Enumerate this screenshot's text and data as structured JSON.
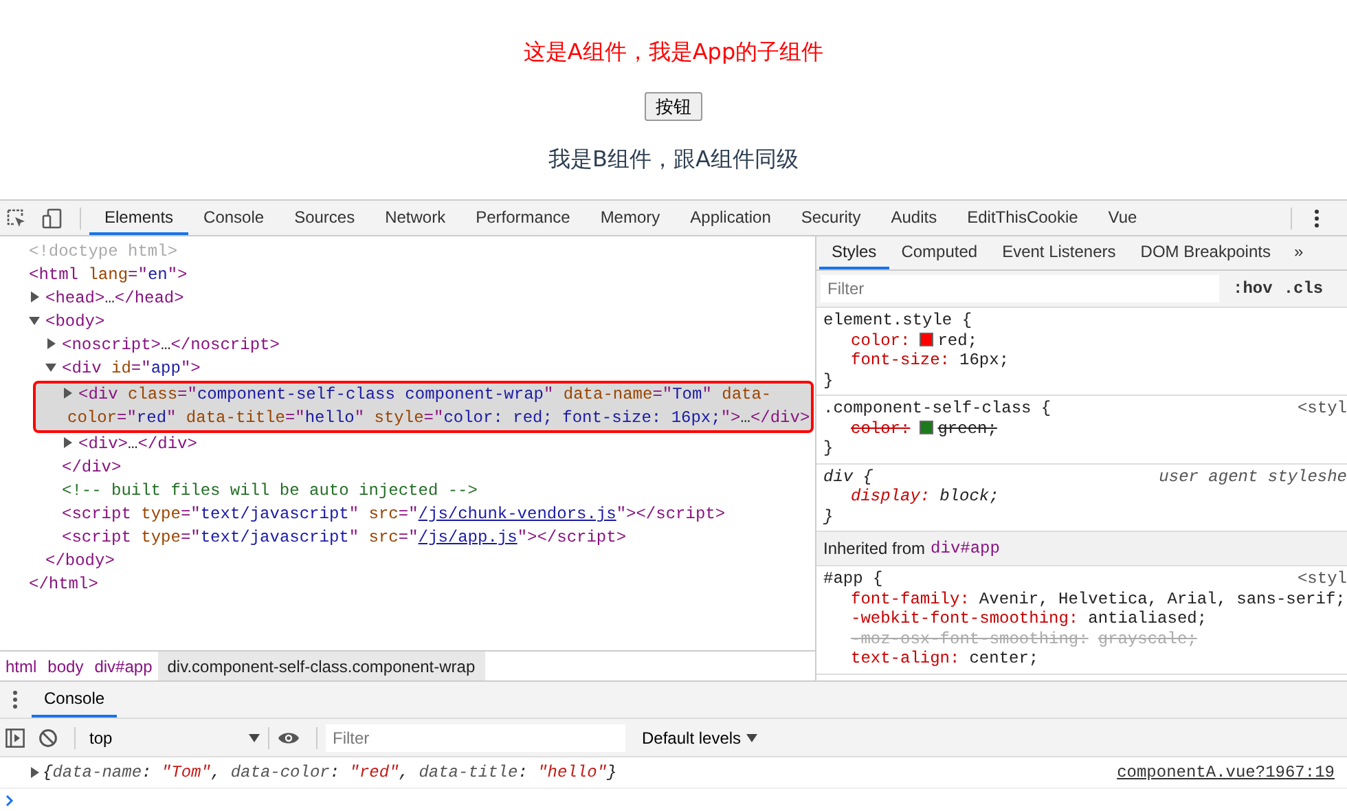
{
  "page": {
    "heading": "这是A组件，我是App的子组件",
    "button": "按钮",
    "sibling_text": "我是B组件，跟A组件同级"
  },
  "devtools_tabs": [
    {
      "label": "Elements",
      "selected": true
    },
    {
      "label": "Console",
      "selected": false
    },
    {
      "label": "Sources",
      "selected": false
    },
    {
      "label": "Network",
      "selected": false
    },
    {
      "label": "Performance",
      "selected": false
    },
    {
      "label": "Memory",
      "selected": false
    },
    {
      "label": "Application",
      "selected": false
    },
    {
      "label": "Security",
      "selected": false
    },
    {
      "label": "Audits",
      "selected": false
    },
    {
      "label": "EditThisCookie",
      "selected": false
    },
    {
      "label": "Vue",
      "selected": false
    }
  ],
  "elements_tree": [
    {
      "selected": false,
      "tokens": [
        {
          "kind": "doctype",
          "text": "<!doctype html>"
        }
      ]
    },
    {
      "selected": false,
      "tokens": [
        {
          "kind": "tag",
          "text": "<html"
        },
        {
          "kind": "attr",
          "text": " lang"
        },
        {
          "kind": "tag",
          "text": "=\""
        },
        {
          "kind": "value",
          "text": "en"
        },
        {
          "kind": "tag",
          "text": "\">"
        }
      ],
      "closing": [
        {
          "kind": "tag",
          "text": "</html>"
        }
      ],
      "children": [
        {
          "selected": false,
          "expanded": false,
          "tokens": [
            {
              "kind": "tag",
              "text": "<head>"
            },
            {
              "kind": "plain",
              "text": "…"
            },
            {
              "kind": "tag",
              "text": "</head>"
            }
          ]
        },
        {
          "selected": false,
          "expanded": true,
          "tokens": [
            {
              "kind": "tag",
              "text": "<body>"
            }
          ],
          "closing": [
            {
              "kind": "tag",
              "text": "</body>"
            }
          ],
          "children": [
            {
              "selected": false,
              "expanded": false,
              "tokens": [
                {
                  "kind": "tag",
                  "text": "<noscript>"
                },
                {
                  "kind": "plain",
                  "text": "…"
                },
                {
                  "kind": "tag",
                  "text": "</noscript>"
                }
              ]
            },
            {
              "selected": false,
              "expanded": true,
              "tokens": [
                {
                  "kind": "tag",
                  "text": "<div"
                },
                {
                  "kind": "attr",
                  "text": " id"
                },
                {
                  "kind": "tag",
                  "text": "=\""
                },
                {
                  "kind": "value",
                  "text": "app"
                },
                {
                  "kind": "tag",
                  "text": "\">"
                }
              ],
              "closing": [
                {
                  "kind": "tag",
                  "text": "</div>"
                }
              ],
              "children": [
                {
                  "selected": true,
                  "expanded": false,
                  "tokens": [
                    {
                      "kind": "tag",
                      "text": "<div"
                    },
                    {
                      "kind": "attr",
                      "text": " class"
                    },
                    {
                      "kind": "tag",
                      "text": "=\""
                    },
                    {
                      "kind": "value",
                      "text": "component-self-class component-wrap"
                    },
                    {
                      "kind": "tag",
                      "text": "\""
                    },
                    {
                      "kind": "attr",
                      "text": " data-name"
                    },
                    {
                      "kind": "tag",
                      "text": "=\""
                    },
                    {
                      "kind": "value",
                      "text": "Tom"
                    },
                    {
                      "kind": "tag",
                      "text": "\""
                    },
                    {
                      "kind": "attr",
                      "text": " data-color"
                    },
                    {
                      "kind": "tag",
                      "text": "=\""
                    },
                    {
                      "kind": "value",
                      "text": "red"
                    },
                    {
                      "kind": "tag",
                      "text": "\""
                    },
                    {
                      "kind": "attr",
                      "text": " data-title"
                    },
                    {
                      "kind": "tag",
                      "text": "=\""
                    },
                    {
                      "kind": "value",
                      "text": "hello"
                    },
                    {
                      "kind": "tag",
                      "text": "\""
                    },
                    {
                      "kind": "attr",
                      "text": " style"
                    },
                    {
                      "kind": "tag",
                      "text": "=\""
                    },
                    {
                      "kind": "value",
                      "text": "color: red; font-size: 16px;"
                    },
                    {
                      "kind": "tag",
                      "text": "\">"
                    },
                    {
                      "kind": "plain",
                      "text": "…"
                    },
                    {
                      "kind": "tag",
                      "text": "</div>"
                    }
                  ]
                },
                {
                  "selected": false,
                  "expanded": false,
                  "tokens": [
                    {
                      "kind": "tag",
                      "text": "<div>"
                    },
                    {
                      "kind": "plain",
                      "text": "…"
                    },
                    {
                      "kind": "tag",
                      "text": "</div>"
                    }
                  ]
                }
              ]
            },
            {
              "selected": false,
              "tokens": [
                {
                  "kind": "comment",
                  "text": "<!-- built files will be auto injected -->"
                }
              ]
            },
            {
              "selected": false,
              "tokens": [
                {
                  "kind": "tag",
                  "text": "<script"
                },
                {
                  "kind": "attr",
                  "text": " type"
                },
                {
                  "kind": "tag",
                  "text": "=\""
                },
                {
                  "kind": "value",
                  "text": "text/javascript"
                },
                {
                  "kind": "tag",
                  "text": "\""
                },
                {
                  "kind": "attr",
                  "text": " src"
                },
                {
                  "kind": "tag",
                  "text": "=\""
                },
                {
                  "kind": "link",
                  "text": "/js/chunk-vendors.js"
                },
                {
                  "kind": "tag",
                  "text": "\"></script>"
                }
              ]
            },
            {
              "selected": false,
              "tokens": [
                {
                  "kind": "tag",
                  "text": "<script"
                },
                {
                  "kind": "attr",
                  "text": " type"
                },
                {
                  "kind": "tag",
                  "text": "=\""
                },
                {
                  "kind": "value",
                  "text": "text/javascript"
                },
                {
                  "kind": "tag",
                  "text": "\""
                },
                {
                  "kind": "attr",
                  "text": " src"
                },
                {
                  "kind": "tag",
                  "text": "=\""
                },
                {
                  "kind": "link",
                  "text": "/js/app.js"
                },
                {
                  "kind": "tag",
                  "text": "\"></script>"
                }
              ]
            }
          ]
        }
      ]
    }
  ],
  "breadcrumbs": [
    {
      "text": "html",
      "selected": false
    },
    {
      "text": "body",
      "selected": false
    },
    {
      "text": "div#app",
      "selected": false
    },
    {
      "text": "div.component-self-class.component-wrap",
      "selected": true
    }
  ],
  "styles_panel": {
    "tabs": [
      {
        "label": "Styles",
        "selected": true
      },
      {
        "label": "Computed",
        "selected": false
      },
      {
        "label": "Event Listeners",
        "selected": false
      },
      {
        "label": "DOM Breakpoints",
        "selected": false
      }
    ],
    "more": "»",
    "filter": {
      "placeholder": "Filter"
    },
    "toggles": [
      ":hov",
      ".cls"
    ],
    "rules": [
      {
        "kind": "rule",
        "selector": "element.style {",
        "close": "}",
        "decls": [
          {
            "name": "color:",
            "value": "red;",
            "color": "#ff0000",
            "struck": false,
            "valid": true
          },
          {
            "name": "font-size:",
            "value": "16px;",
            "struck": false,
            "valid": true
          }
        ]
      },
      {
        "kind": "rule",
        "selector": ".component-self-class {",
        "source": "<styl",
        "close": "}",
        "decls": [
          {
            "name": "color:",
            "value": "green;",
            "color": "#1b7a1b",
            "struck": true,
            "valid": true
          }
        ]
      },
      {
        "kind": "user-agent",
        "selector": "div {",
        "source": "user agent styleshe",
        "close": "}",
        "decls": [
          {
            "name": "display:",
            "value": "block;",
            "struck": false,
            "valid": true
          }
        ]
      },
      {
        "kind": "inherited",
        "label": "Inherited from",
        "target": "div#app"
      },
      {
        "kind": "rule",
        "selector": "#app {",
        "source": "<styl",
        "decls": [
          {
            "name": "font-family:",
            "value": "Avenir, Helvetica, Arial, sans-serif;",
            "struck": false,
            "valid": true
          },
          {
            "name": "-webkit-font-smoothing:",
            "value": "antialiased;",
            "struck": false,
            "valid": true
          },
          {
            "name": "-moz-osx-font-smoothing:",
            "value": "grayscale;",
            "struck": true,
            "valid": false
          },
          {
            "name": "text-align:",
            "value": "center;",
            "struck": false,
            "valid": true
          }
        ]
      }
    ]
  },
  "console_drawer": {
    "tabs": [
      {
        "label": "Console",
        "selected": true
      }
    ],
    "context": "top",
    "filter": {
      "placeholder": "Filter"
    },
    "levels": "Default levels",
    "messages": [
      {
        "expanded": false,
        "source": "componentA.vue?1967:19",
        "tokens": [
          {
            "kind": "punct",
            "text": "{"
          },
          {
            "kind": "key",
            "text": "data-name"
          },
          {
            "kind": "punct",
            "text": ": "
          },
          {
            "kind": "string",
            "text": "\"Tom\""
          },
          {
            "kind": "punct",
            "text": ", "
          },
          {
            "kind": "key",
            "text": "data-color"
          },
          {
            "kind": "punct",
            "text": ": "
          },
          {
            "kind": "string",
            "text": "\"red\""
          },
          {
            "kind": "punct",
            "text": ", "
          },
          {
            "kind": "key",
            "text": "data-title"
          },
          {
            "kind": "punct",
            "text": ": "
          },
          {
            "kind": "string",
            "text": "\"hello\""
          },
          {
            "kind": "punct",
            "text": "}"
          }
        ]
      }
    ]
  }
}
